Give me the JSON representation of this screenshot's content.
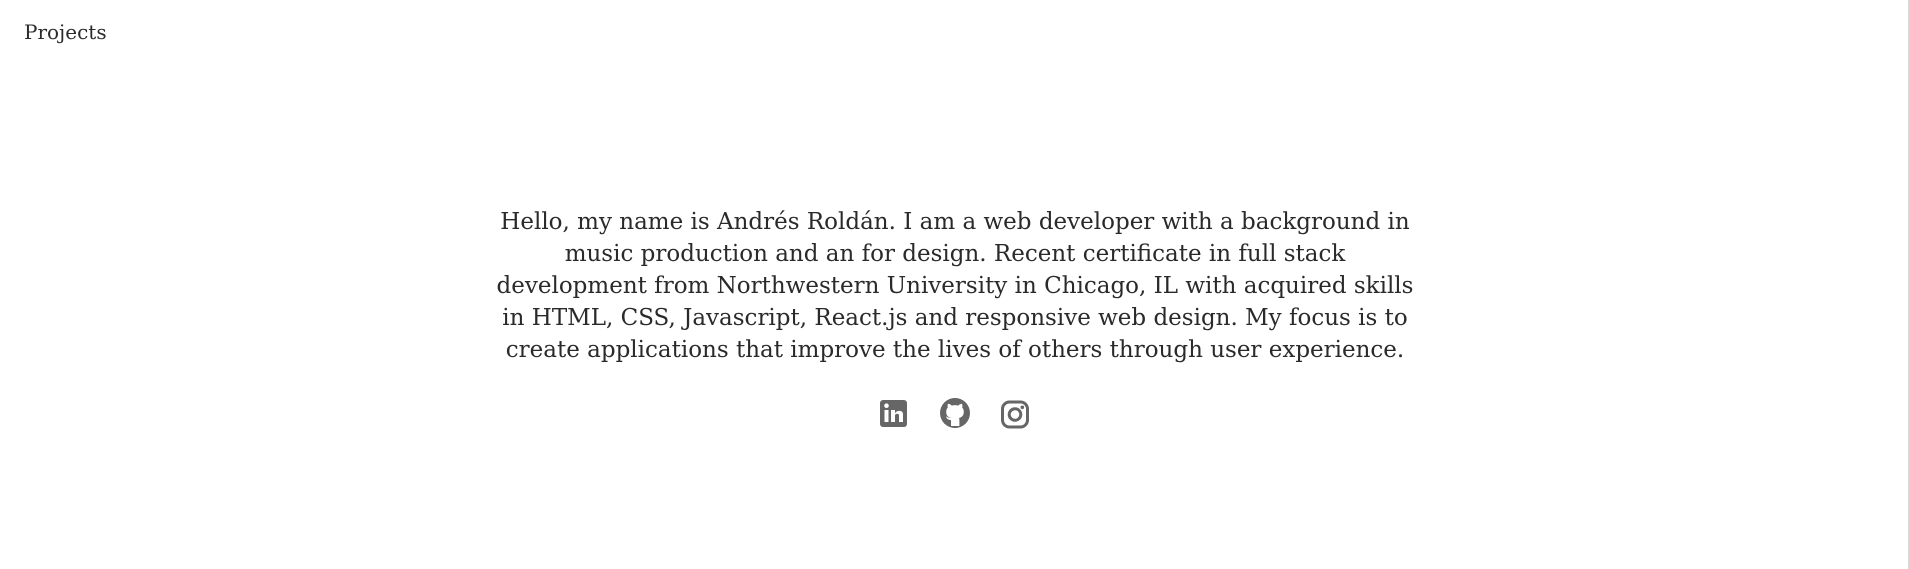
{
  "nav": {
    "projects_label": "Projects"
  },
  "intro": {
    "text": "Hello, my name is Andrés Roldán. I am a web developer with a background in music production and an for design. Recent certificate in full stack development from Northwestern University in Chicago, IL with acquired skills in HTML, CSS, Javascript, React.js and responsive web design. My focus is to create applications that improve the lives of others through user experience."
  },
  "social": {
    "icons": [
      "linkedin-icon",
      "github-icon",
      "instagram-icon"
    ],
    "icon_color": "#666666"
  },
  "colors": {
    "text": "#2a2a2a",
    "background": "#ffffff"
  }
}
